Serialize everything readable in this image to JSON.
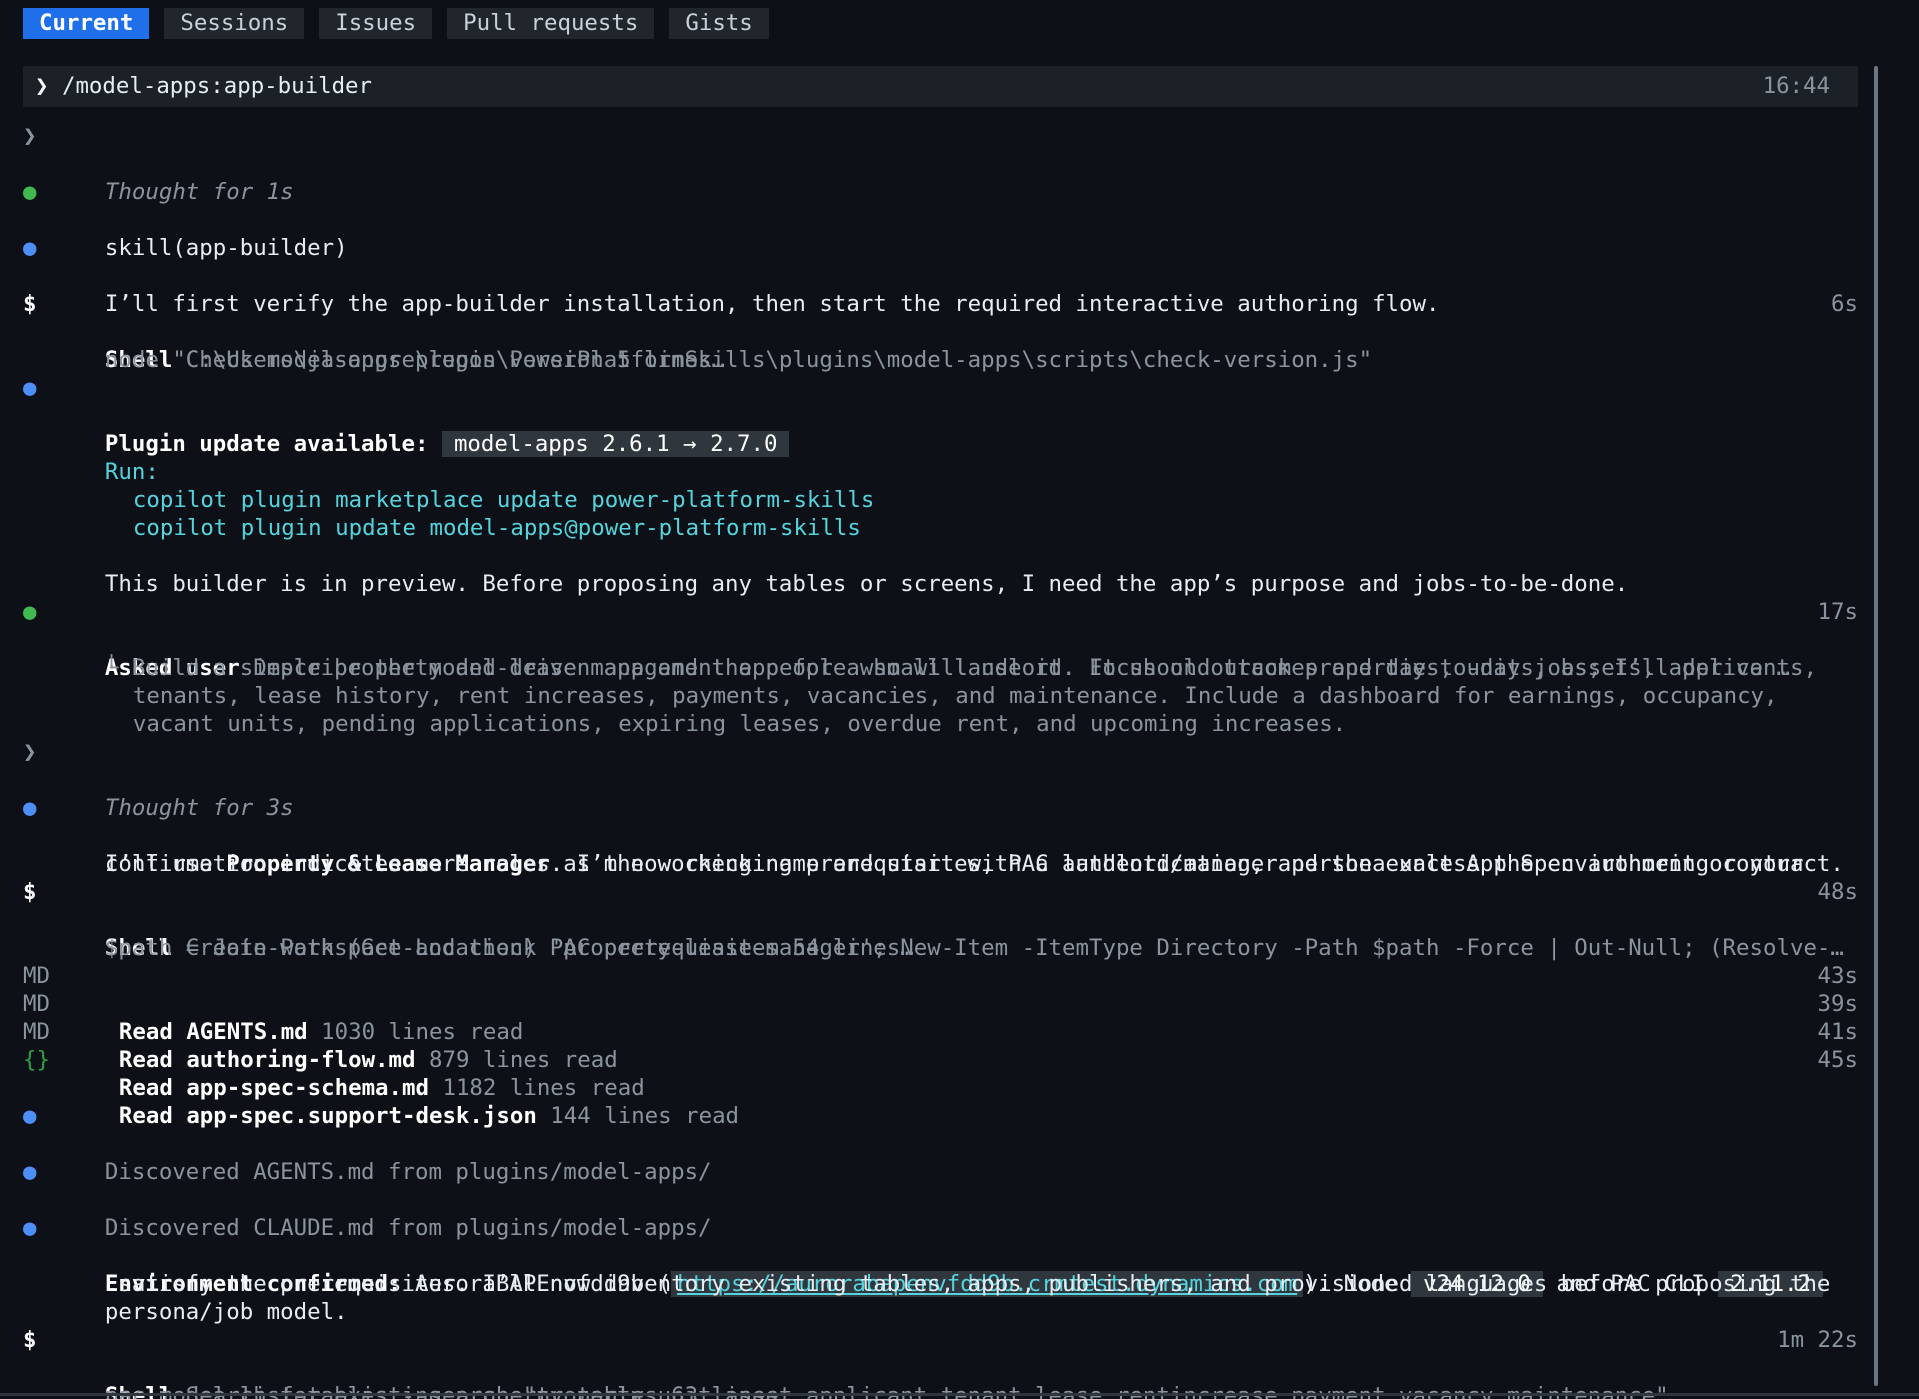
{
  "tabs": [
    {
      "label": "Current",
      "active": true
    },
    {
      "label": "Sessions",
      "active": false
    },
    {
      "label": "Issues",
      "active": false
    },
    {
      "label": "Pull requests",
      "active": false
    },
    {
      "label": "Gists",
      "active": false
    }
  ],
  "prompt": {
    "chevron": "❯",
    "command": "/model-apps:app-builder",
    "time": "16:44"
  },
  "thought1": {
    "chevron": "❯",
    "text": "Thought for 1s"
  },
  "skill": {
    "dot": "●",
    "text": "skill(app-builder)"
  },
  "msg1": {
    "dot": "●",
    "text": "I’ll first verify the app-builder installation, then start the required interactive authoring flow."
  },
  "shell1": {
    "symbol": "$",
    "title": "Shell",
    "desc": " Check model-apps plugin version 5 lines…",
    "duration": "6s",
    "cmd": "node \"C:\\Users\\jasongre\\repos\\PowerPlatformSkills\\plugins\\model-apps\\scripts\\check-version.js\""
  },
  "update": {
    "dot": "●",
    "label": "Plugin update available:",
    "version": "model-apps 2.6.1 → 2.7.0",
    "run_label": "Run:",
    "cmd1": "copilot plugin marketplace update power-platform-skills",
    "cmd2": "copilot plugin update model-apps@power-platform-skills",
    "note": "This builder is in preview. Before proposing any tables or screens, I need the app’s purpose and jobs-to-be-done."
  },
  "asked": {
    "dot": "●",
    "label": "Asked user",
    "question": " Describe the model-driven app and the people who will use it. Focus on outcomes and day-to-day jobs; I’ll derive …",
    "duration": "17s",
    "branch": "└",
    "answer1": "Build a simple property and lease management app for a small landlord. It should track properties, units, assets, applicants,",
    "answer2": "tenants, lease history, rent increases, payments, vacancies, and maintenance. Include a dashboard for earnings, occupancy,",
    "answer3": "vacant units, pending applications, expiring leases, overdue rent, and upcoming increases."
  },
  "thought2": {
    "chevron": "❯",
    "text": "Thought for 3s"
  },
  "msg2": {
    "dot": "●",
    "pre": "I’ll use ",
    "bold": "Property & Lease Manager",
    "post": " as the working name and start with a landlord/manager persona unless the environment or your",
    "line2": "confirmation indicates more roles. I’m now checking prerequisites, PAC authentication, and the exact App Spec authoring contract."
  },
  "shell2": {
    "symbol": "$",
    "title": "Shell",
    "desc": " Create workspace and check PAC prerequisites 54 lines…",
    "duration": "48s",
    "cmd": "$path = Join-Path (Get-Location) 'property-lease-manager'; New-Item -ItemType Directory -Path $path -Force | Out-Null; (Resolve-…"
  },
  "reads": [
    {
      "tag": "MD",
      "verb": "Read",
      "file": "AGENTS.md",
      "info": " 1030 lines read",
      "duration": "43s"
    },
    {
      "tag": "MD",
      "verb": "Read",
      "file": "authoring-flow.md",
      "info": " 879 lines read",
      "duration": "39s"
    },
    {
      "tag": "MD",
      "verb": "Read",
      "file": "app-spec-schema.md",
      "info": " 1182 lines read",
      "duration": "41s"
    },
    {
      "tag": "{}",
      "verb": "Read",
      "file": "app-spec.support-desk.json",
      "info": " 144 lines read",
      "duration": "45s"
    }
  ],
  "disc1": {
    "dot": "●",
    "text": "Discovered AGENTS.md from plugins/model-apps/"
  },
  "disc2": {
    "dot": "●",
    "text": "Discovered CLAUDE.md from plugins/model-apps/"
  },
  "env": {
    "dot": "●",
    "label": "Environment confirmed:",
    "env_name": " AuroraBAPEnvfdd9b (",
    "url": "https://aurorabapenvfdd9b.crmtest.dynamics.com",
    "after_url": "). Node ",
    "node_version": "v24.12.0",
    "mid": " and PAC CLI ",
    "pac_version": "2.11.2",
    "line2": " satisfy the prerequisites. I’ll now inventory existing tables, apps, publishers, and provisioned languages before proposing the",
    "line3": "persona/job model."
  },
  "shell3": {
    "symbol": "$",
    "title": "Shell",
    "desc": " Search for existing property tables 63 lines…",
    "duration": "1m 22s",
    "cmd": "pac model list-tables --search \"property,unit,asset,applicant,tenant,lease,rentincrease,payment,vacancy,maintenance\""
  },
  "colors": {
    "background": "#0d1117",
    "active_tab": "#1f6feb",
    "cyan": "#56d4dd",
    "green": "#3fb950",
    "blue": "#4f8ef7"
  }
}
